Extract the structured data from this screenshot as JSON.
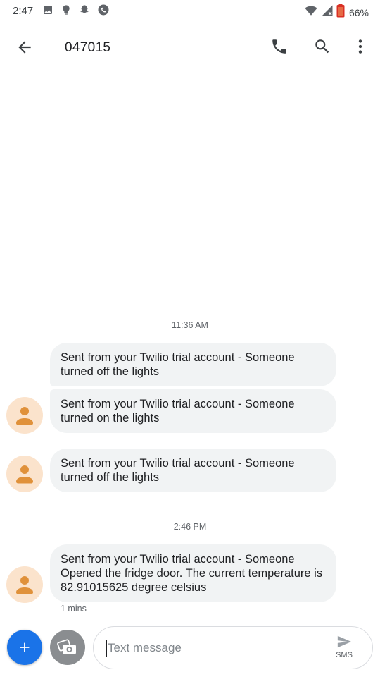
{
  "status_bar": {
    "time": "2:47",
    "battery": "66%",
    "icons": [
      "image-icon",
      "lightbulb-icon",
      "snapchat-icon",
      "whatsapp-icon",
      "wifi-icon",
      "signal-icon",
      "battery-icon"
    ]
  },
  "toolbar": {
    "contact": "047015",
    "icons": [
      "back-arrow-icon",
      "phone-icon",
      "search-icon",
      "more-vert-icon"
    ]
  },
  "conversation": {
    "time_groups": [
      "11:36 AM",
      "2:46 PM"
    ],
    "messages": [
      {
        "text": "Sent from your Twilio trial account - Someone turned off the lights"
      },
      {
        "text": "Sent from your Twilio trial account - Someone turned on the lights"
      },
      {
        "text": "Sent from your Twilio trial account - Someone turned off the lights"
      },
      {
        "text": "Sent from your Twilio trial account - Someone Opened the fridge door. The current temperature is 82.91015625 degree celsius"
      }
    ],
    "last_meta": "1 mins"
  },
  "compose": {
    "placeholder": "Text message",
    "send_label": "SMS"
  },
  "colors": {
    "accent": "#1a73e8",
    "bubble": "#f1f3f4",
    "avatar_bg": "#fbe3cc",
    "avatar_fg": "#e0913a"
  }
}
